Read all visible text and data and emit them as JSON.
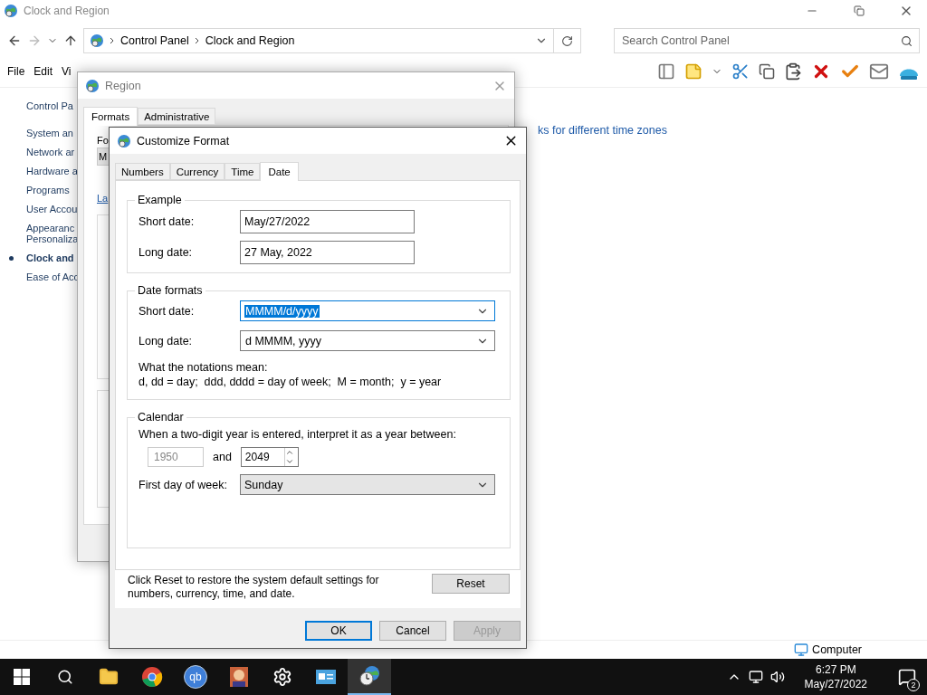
{
  "explorer": {
    "title": "Clock and Region",
    "breadcrumb": [
      "Control Panel",
      "Clock and Region"
    ],
    "search": {
      "placeholder": "Search Control Panel"
    },
    "menu": [
      "File",
      "Edit",
      "Vi"
    ],
    "sidebar": {
      "header": "Control Pa",
      "items": [
        {
          "label": "System an",
          "selected": false
        },
        {
          "label": "Network ar",
          "selected": false
        },
        {
          "label": "Hardware a",
          "selected": false
        },
        {
          "label": "Programs",
          "selected": false
        },
        {
          "label": "User Accou",
          "selected": false
        },
        {
          "label": "Appearanc",
          "label_2": "Personaliza",
          "selected": false
        },
        {
          "label": "Clock and",
          "selected": true
        },
        {
          "label": "Ease of Acc",
          "selected": false
        }
      ]
    },
    "link": "ks for different time zones",
    "status_bar": "Computer"
  },
  "region": {
    "title": "Region",
    "tabs": [
      {
        "label": "Formats",
        "selected": true
      },
      {
        "label": "Administrative",
        "selected": false
      }
    ],
    "format_label": "Fo",
    "format_value": "M",
    "link": "La"
  },
  "customize": {
    "title": "Customize Format",
    "tabs": [
      {
        "label": "Numbers",
        "selected": false
      },
      {
        "label": "Currency",
        "selected": false
      },
      {
        "label": "Time",
        "selected": false
      },
      {
        "label": "Date",
        "selected": true
      }
    ],
    "example": {
      "title": "Example",
      "rows": [
        {
          "label": "Short date:",
          "value": "May/27/2022"
        },
        {
          "label": "Long date:",
          "value": "27 May, 2022"
        }
      ]
    },
    "date_formats": {
      "title": "Date formats",
      "rows": [
        {
          "label": "Short date:",
          "value": "MMMM/d/yyyy",
          "focused": true
        },
        {
          "label": "Long date:",
          "value": "d MMMM, yyyy",
          "focused": false
        }
      ],
      "help_title": "What the notations mean:",
      "help": "d, dd = day;  ddd, dddd = day of week;  M = month;  y = year"
    },
    "calendar": {
      "title": "Calendar",
      "prompt": "When a two-digit year is entered, interpret it as a year between:",
      "from": {
        "value": "1950",
        "disabled": true
      },
      "and": "and",
      "to": "2049",
      "first_day_label": "First day of week:",
      "first_day": "Sunday"
    },
    "reset_note": "Click Reset to restore the system default settings for numbers, currency, time, and date.",
    "reset": "Reset",
    "buttons": [
      {
        "label": "OK",
        "kind": "default"
      },
      {
        "label": "Cancel",
        "kind": "normal"
      },
      {
        "label": "Apply",
        "kind": "disabled"
      }
    ]
  },
  "taskbar": {
    "apps": [
      {
        "kind": "folder",
        "active": false
      },
      {
        "kind": "chrome",
        "active": false
      },
      {
        "kind": "qb",
        "label": "qb",
        "active": false
      },
      {
        "kind": "game",
        "active": false
      },
      {
        "kind": "settings",
        "active": false
      },
      {
        "kind": "card",
        "active": false
      },
      {
        "kind": "clock",
        "active": true
      }
    ],
    "time": "6:27 PM",
    "date": "May/27/2022",
    "notifications": "2"
  }
}
